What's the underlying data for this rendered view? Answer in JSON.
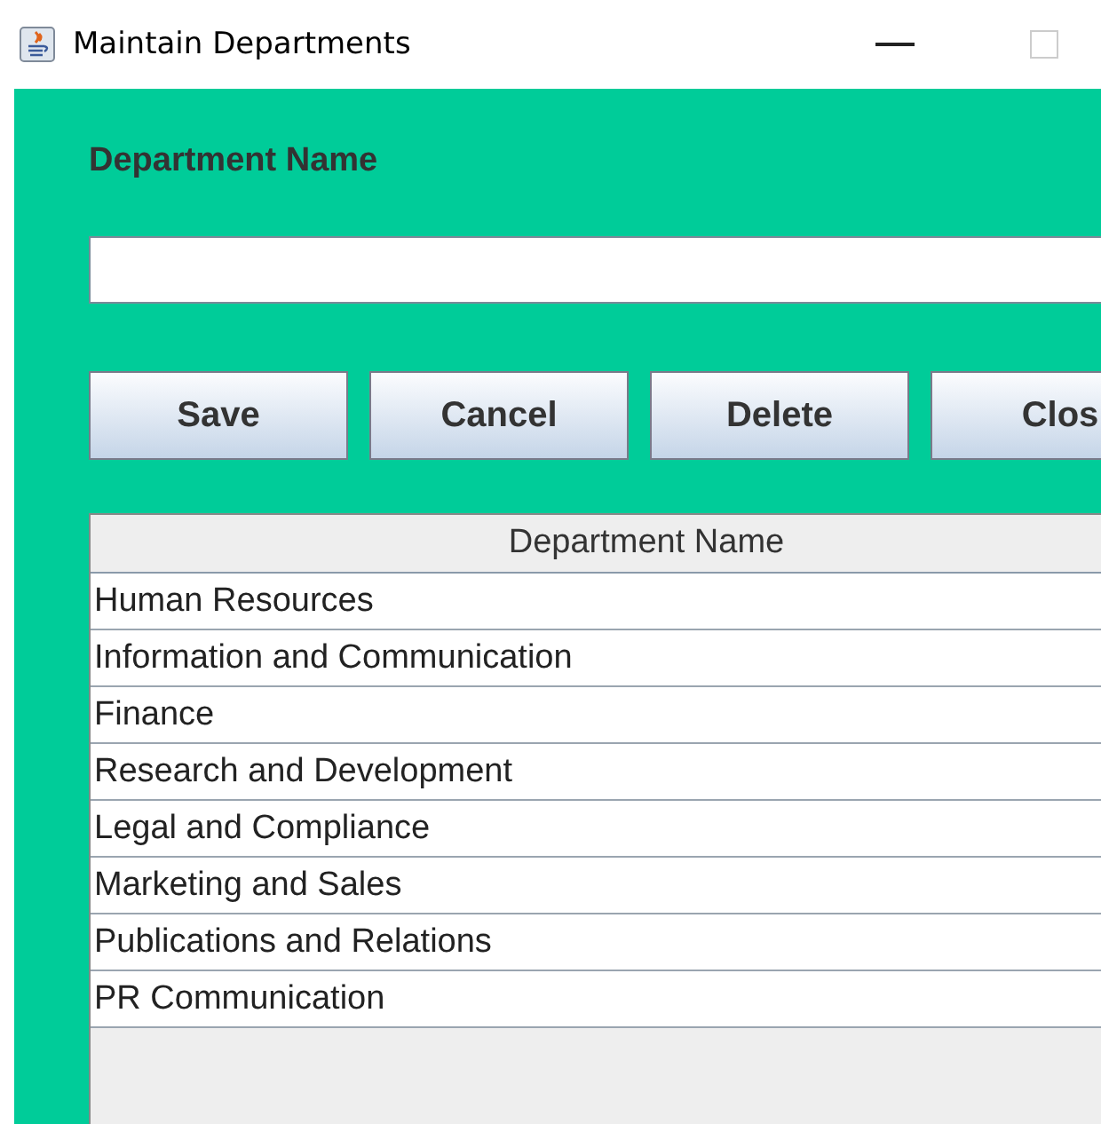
{
  "window": {
    "title": "Maintain Departments"
  },
  "form": {
    "label": "Department Name"
  },
  "buttons": [
    "Save",
    "Cancel",
    "Delete",
    "Clos"
  ],
  "table": {
    "columns": [
      "Department Name"
    ],
    "rows": [
      "Human Resources",
      "Information and Communication",
      "Finance",
      "Research and Development",
      "Legal and Compliance",
      "Marketing and Sales",
      "Publications and Relations",
      "PR Communication"
    ]
  }
}
